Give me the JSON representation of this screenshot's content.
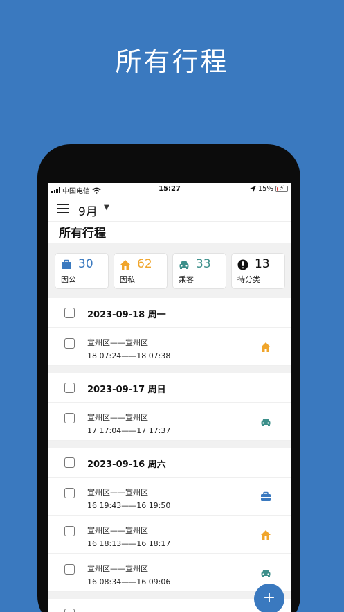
{
  "promo": {
    "title": "所有行程"
  },
  "status_bar": {
    "carrier": "中国电信",
    "time": "15:27",
    "battery": "15%",
    "battery_level": 0.15
  },
  "app_bar": {
    "month": "9月"
  },
  "page": {
    "title": "所有行程"
  },
  "colors": {
    "business": "#3a79bf",
    "personal": "#f0a52b",
    "passenger": "#3c8f8a",
    "pending": "#111111",
    "accent": "#3a79bf"
  },
  "summary": [
    {
      "icon": "briefcase-icon",
      "count": "30",
      "label": "因公",
      "color": "#3a79bf"
    },
    {
      "icon": "home-icon",
      "count": "62",
      "label": "因私",
      "color": "#f0a52b"
    },
    {
      "icon": "car-icon",
      "count": "33",
      "label": "乘客",
      "color": "#3c8f8a"
    },
    {
      "icon": "exclamation-icon",
      "count": "13",
      "label": "待分类",
      "color": "#111111"
    }
  ],
  "groups": [
    {
      "date": "2023-09-18 周一",
      "trips": [
        {
          "route": "宣州区——宣州区",
          "time": "18 07:24——18 07:38",
          "category_icon": "home-icon"
        }
      ]
    },
    {
      "date": "2023-09-17 周日",
      "trips": [
        {
          "route": "宣州区——宣州区",
          "time": "17 17:04——17 17:37",
          "category_icon": "car-icon"
        }
      ]
    },
    {
      "date": "2023-09-16 周六",
      "trips": [
        {
          "route": "宣州区——宣州区",
          "time": "16 19:43——16 19:50",
          "category_icon": "briefcase-icon"
        },
        {
          "route": "宣州区——宣州区",
          "time": "16 18:13——16 18:17",
          "category_icon": "home-icon"
        },
        {
          "route": "宣州区——宣州区",
          "time": "16 08:34——16 09:06",
          "category_icon": "car-icon"
        }
      ]
    }
  ],
  "fab": {
    "label": "+"
  }
}
